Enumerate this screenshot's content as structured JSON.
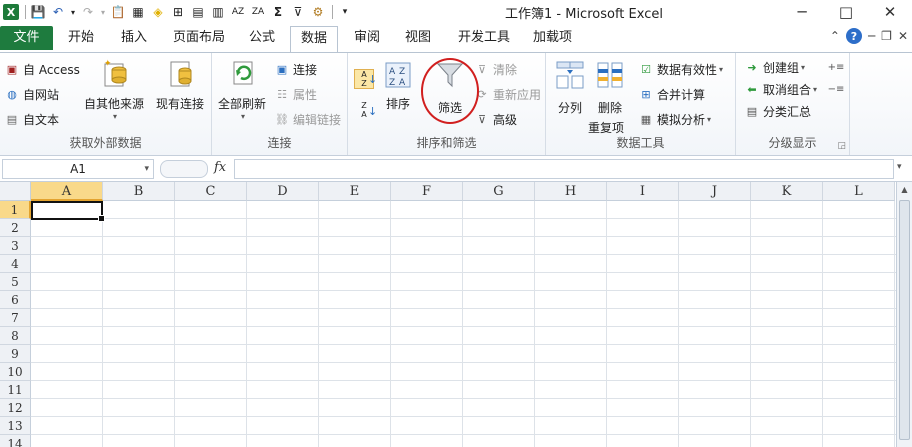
{
  "window": {
    "title": "工作簿1 - Microsoft Excel",
    "minimize": "─",
    "maximize": "□",
    "close": "✕"
  },
  "tabs": [
    {
      "label": "文件"
    },
    {
      "label": "开始"
    },
    {
      "label": "插入"
    },
    {
      "label": "页面布局"
    },
    {
      "label": "公式"
    },
    {
      "label": "数据"
    },
    {
      "label": "审阅"
    },
    {
      "label": "视图"
    },
    {
      "label": "开发工具"
    },
    {
      "label": "加载项"
    }
  ],
  "active_tab": "数据",
  "groups": {
    "external": {
      "label": "获取外部数据",
      "access": "自 Access",
      "web": "自网站",
      "text": "自文本",
      "other": "自其他来源",
      "existing": "现有连接"
    },
    "connections": {
      "label": "连接",
      "refresh_all": "全部刷新",
      "connections": "连接",
      "properties": "属性",
      "edit_links": "编辑链接"
    },
    "sort_filter": {
      "label": "排序和筛选",
      "sort_az": "A↓Z",
      "sort_za": "Z↓A",
      "sort": "排序",
      "filter": "筛选",
      "clear": "清除",
      "reapply": "重新应用",
      "advanced": "高级"
    },
    "data_tools": {
      "label": "数据工具",
      "split": "分列",
      "remove_dup_1": "删除",
      "remove_dup_2": "重复项",
      "validation": "数据有效性",
      "consolidate": "合并计算",
      "whatif": "模拟分析"
    },
    "outline": {
      "label": "分级显示",
      "group": "创建组",
      "ungroup": "取消组合",
      "subtotal": "分类汇总"
    }
  },
  "formula_bar": {
    "name_box": "A1",
    "fx": "fx",
    "content": ""
  },
  "columns": [
    "A",
    "B",
    "C",
    "D",
    "E",
    "F",
    "G",
    "H",
    "I",
    "J",
    "K",
    "L"
  ],
  "rows": [
    "1",
    "2",
    "3",
    "4",
    "5",
    "6",
    "7",
    "8",
    "9",
    "10",
    "11",
    "12",
    "13",
    "14"
  ],
  "active_cell": "A1"
}
